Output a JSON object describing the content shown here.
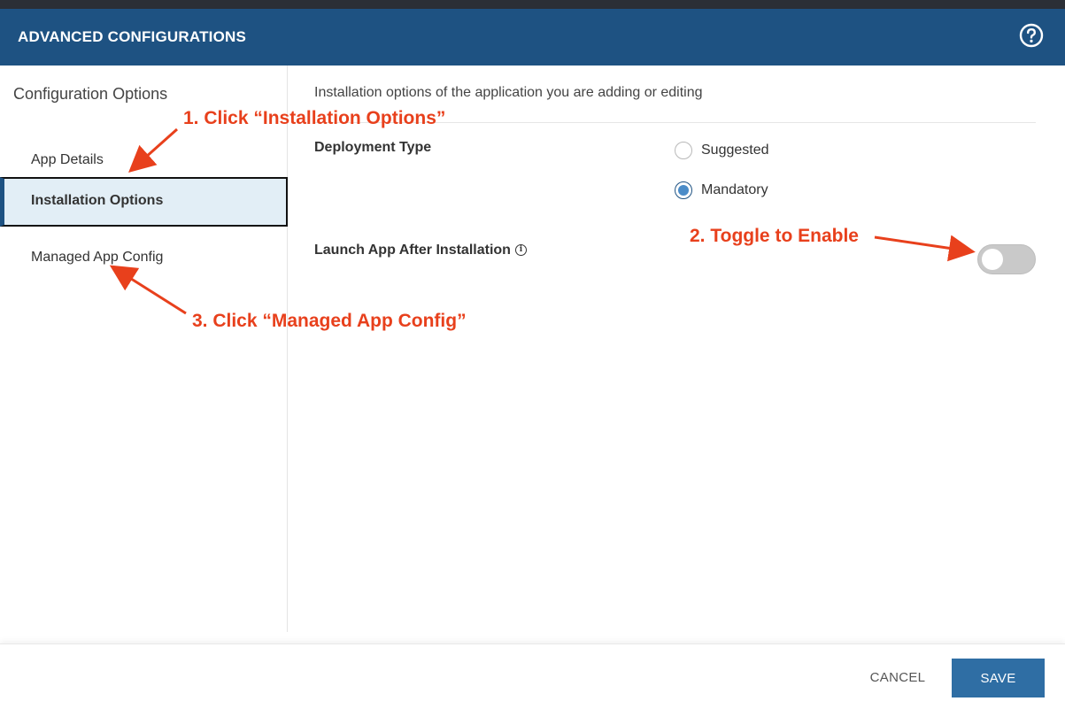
{
  "modal": {
    "title": "ADVANCED CONFIGURATIONS",
    "help_icon": "question-circle-icon"
  },
  "sidebar": {
    "heading": "Configuration Options",
    "items": [
      {
        "label": "App Details",
        "active": false
      },
      {
        "label": "Installation Options",
        "active": true
      },
      {
        "label": "Managed App Config",
        "active": false
      }
    ]
  },
  "content": {
    "description": "Installation options of the application you are adding or editing",
    "deployment_type": {
      "label": "Deployment Type",
      "options": [
        {
          "label": "Suggested",
          "selected": false
        },
        {
          "label": "Mandatory",
          "selected": true
        }
      ]
    },
    "launch_app": {
      "label": "Launch App After Installation",
      "info_icon": "info-circle-icon",
      "enabled": false
    }
  },
  "footer": {
    "cancel_label": "CANCEL",
    "save_label": "SAVE"
  },
  "annotations": {
    "step1": "1.  Click “Installation Options”",
    "step2": "2. Toggle to Enable",
    "step3": "3. Click “Managed App Config”"
  },
  "colors": {
    "header": "#1e5282",
    "active_item_bg": "#e2eef6",
    "save_button": "#2f6ea4",
    "annotation": "#e8401c",
    "radio_selected": "#4b8cc8"
  }
}
